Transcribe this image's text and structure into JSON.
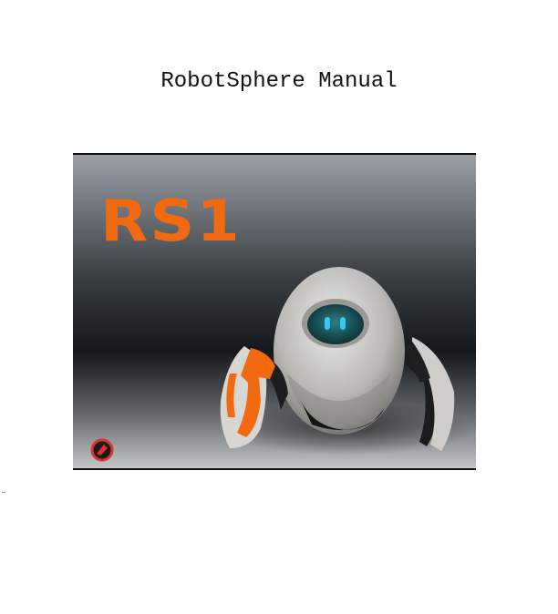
{
  "document": {
    "title": "RobotSphere Manual"
  },
  "cover": {
    "logo_text": "RS1",
    "logo_color": "#f26a10",
    "robot_eye_color": "#39c6f0",
    "badge_icon": "robot-badge-icon"
  }
}
